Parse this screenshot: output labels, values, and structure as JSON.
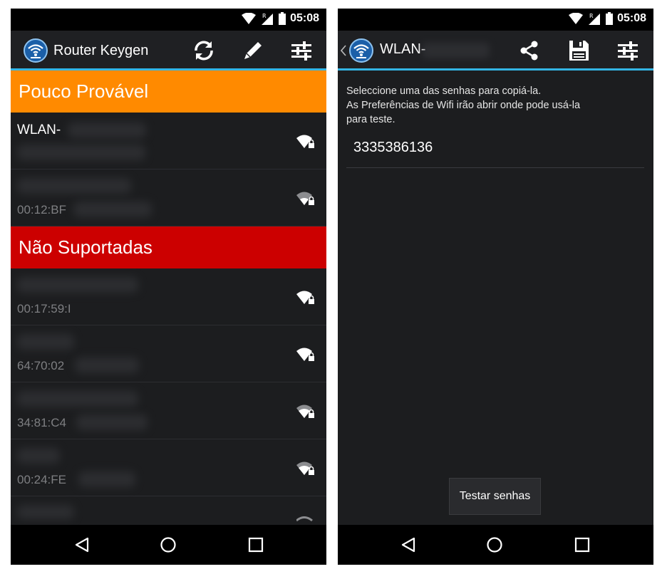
{
  "status": {
    "time": "05:08",
    "roaming": "R"
  },
  "left_screen": {
    "title": "Router Keygen",
    "sections": [
      {
        "header": "Pouco Provável",
        "color": "#ff8a00",
        "items": [
          {
            "ssid": "WLAN-",
            "mac": ""
          },
          {
            "ssid": "",
            "mac": "00:12:BF"
          }
        ]
      },
      {
        "header": "Não Suportadas",
        "color": "#cc0000",
        "items": [
          {
            "ssid": "",
            "mac": "00:17:59:I"
          },
          {
            "ssid": "",
            "mac": "64:70:02"
          },
          {
            "ssid": "",
            "mac": "34:81:C4"
          },
          {
            "ssid": "",
            "mac": "00:24:FE"
          }
        ]
      }
    ]
  },
  "right_screen": {
    "title": "WLAN-",
    "instructions": "Seleccione uma das senhas para copiá-la.\nAs Preferências de Wifi irão abrir onde pode usá-la para teste.",
    "instruction_lines": [
      "Seleccione uma das senhas para copiá-la.",
      "As Preferências de Wifi irão abrir onde pode usá-la",
      "para teste."
    ],
    "passwords": [
      "3335386136"
    ],
    "test_button": "Testar senhas"
  },
  "icons": {
    "refresh": "refresh-icon",
    "edit": "pencil-icon",
    "settings": "sliders-icon",
    "share": "share-icon",
    "save": "save-icon",
    "back": "back-icon",
    "home": "home-icon",
    "recents": "recents-icon"
  },
  "colors": {
    "accent": "#33b5e5",
    "orange": "#ff8a00",
    "red": "#cc0000"
  }
}
